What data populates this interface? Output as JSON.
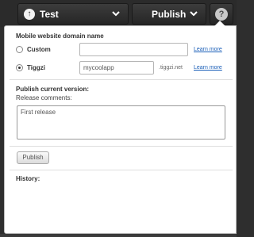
{
  "toolbar": {
    "test_label": "Test",
    "publish_label": "Publish",
    "help_label": "?"
  },
  "panel": {
    "domain_heading": "Mobile website domain name",
    "options": [
      {
        "label": "Custom",
        "value": "",
        "placeholder": "",
        "selected": false,
        "suffix": "",
        "learn_more": "Learn more"
      },
      {
        "label": "Tiggzi",
        "value": "mycoolapp",
        "placeholder": "",
        "selected": true,
        "suffix": ".tiggzi.net",
        "learn_more": "Learn more"
      }
    ],
    "publish_heading": "Publish current version:",
    "release_comments_label": "Release comments:",
    "release_comments_value": "First release",
    "publish_button": "Publish",
    "history_heading": "History:"
  }
}
